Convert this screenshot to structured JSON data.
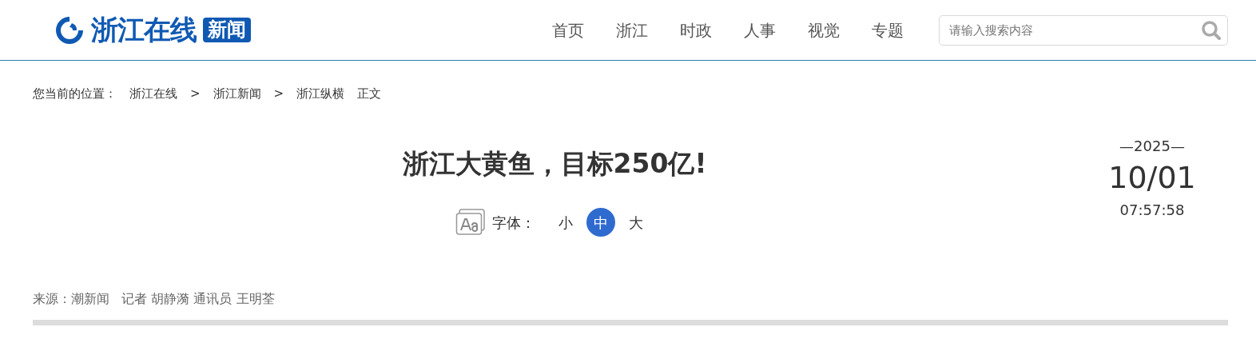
{
  "logo": {
    "name": "浙江在线",
    "badge": "新闻"
  },
  "nav": [
    {
      "label": "首页"
    },
    {
      "label": "浙江"
    },
    {
      "label": "时政"
    },
    {
      "label": "人事"
    },
    {
      "label": "视觉"
    },
    {
      "label": "专题"
    }
  ],
  "search": {
    "placeholder": "请输入搜索内容"
  },
  "breadcrumb": {
    "label": "您当前的位置：",
    "items": [
      {
        "label": "浙江在线",
        "separator": ">"
      },
      {
        "label": "浙江新闻",
        "separator": ">"
      },
      {
        "label": "浙江纵横"
      },
      {
        "label": "正文"
      }
    ]
  },
  "article": {
    "title": "浙江大黄鱼，目标250亿!",
    "font_size": {
      "label": "字体：",
      "options": [
        {
          "label": "小",
          "selected": false
        },
        {
          "label": "中",
          "selected": true
        },
        {
          "label": "大",
          "selected": false
        }
      ]
    },
    "date": {
      "year": "—2025—",
      "day": "10/01",
      "time": "07:57:58"
    },
    "source": "来源：潮新闻   记者 胡静漪 通讯员 王明荃"
  }
}
